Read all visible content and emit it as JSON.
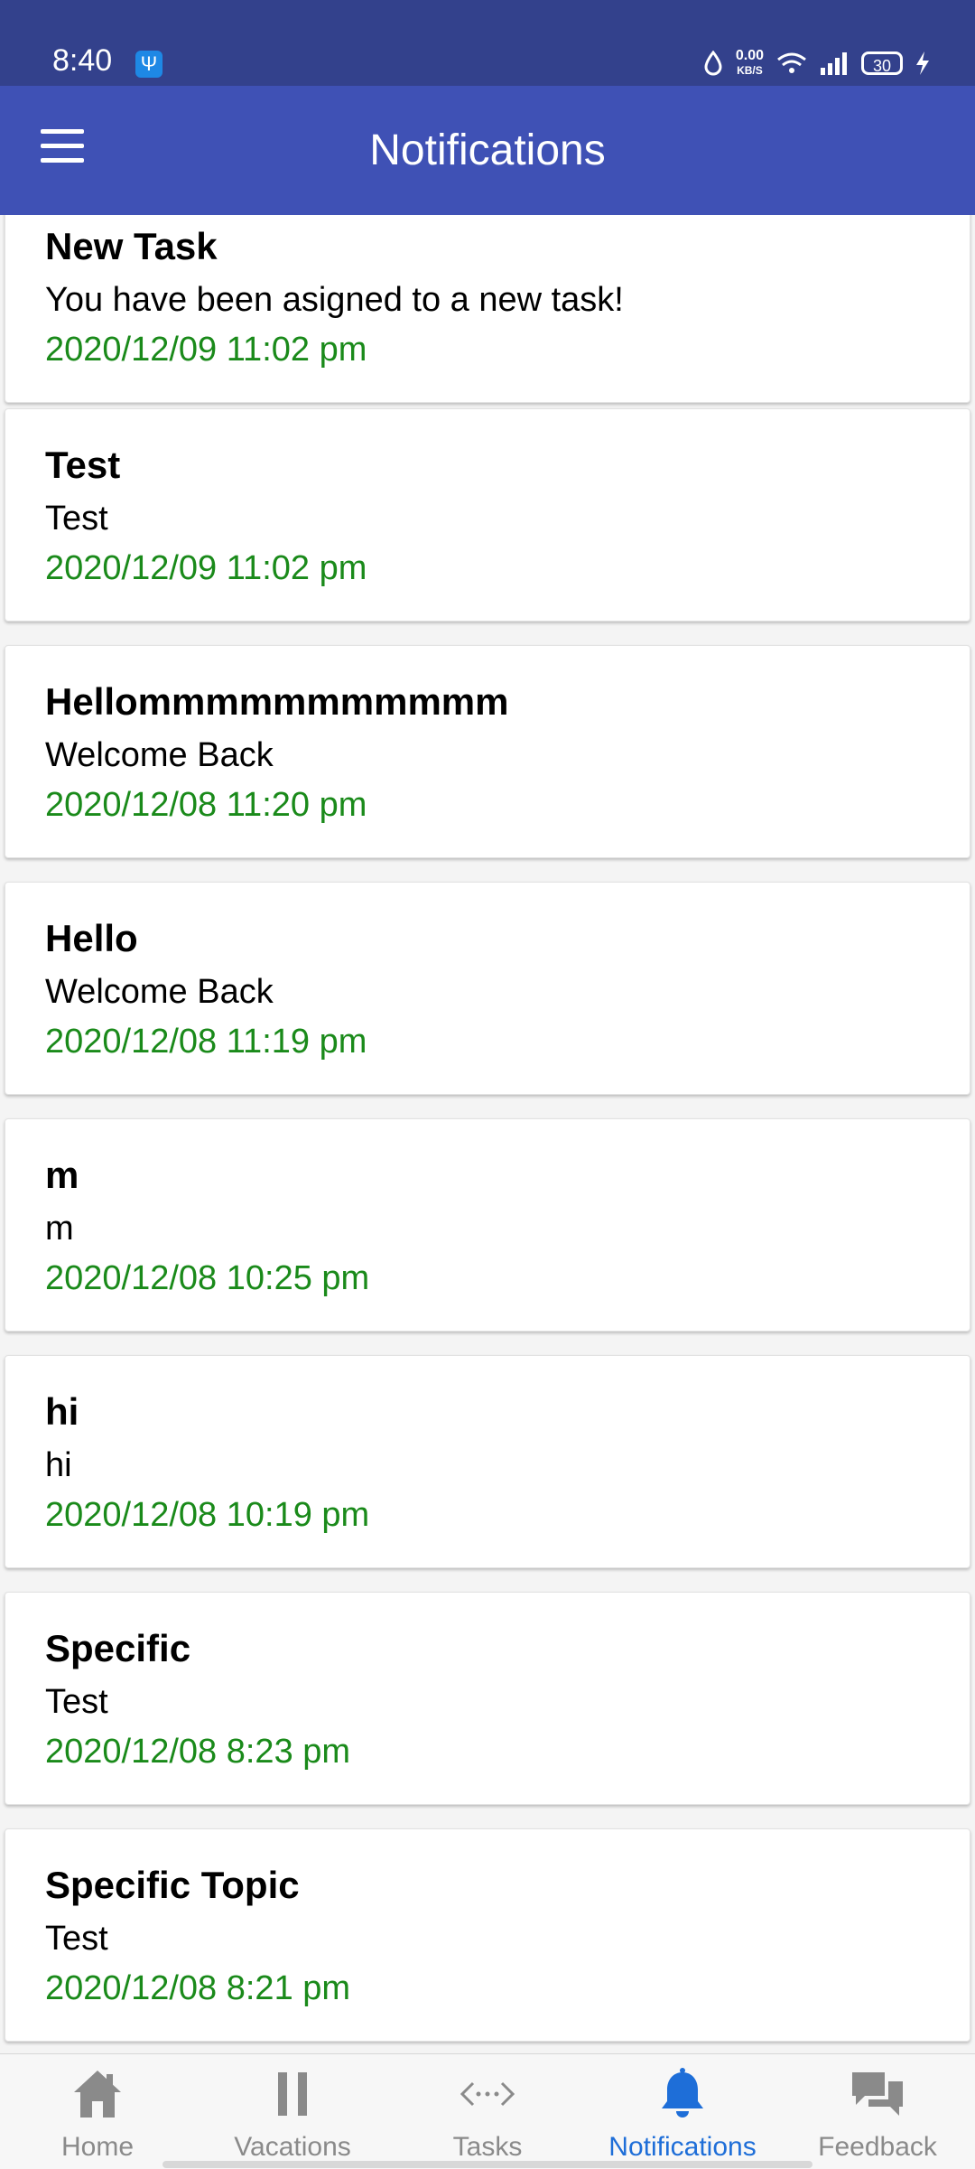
{
  "status_bar": {
    "time": "8:40",
    "net_speed_value": "0.00",
    "net_speed_unit": "KB/S",
    "battery_level": "30"
  },
  "app_bar": {
    "title": "Notifications"
  },
  "notifications": [
    {
      "title": "New Task",
      "body": "You have been asigned to a new task!",
      "time": "2020/12/09 11:02 pm"
    },
    {
      "title": "Test",
      "body": "Test",
      "time": "2020/12/09 11:02 pm"
    },
    {
      "title": "Hellommmmmmmmmmm",
      "body": "Welcome Back",
      "time": "2020/12/08 11:20 pm"
    },
    {
      "title": "Hello",
      "body": "Welcome Back",
      "time": "2020/12/08 11:19 pm"
    },
    {
      "title": "m",
      "body": "m",
      "time": "2020/12/08 10:25 pm"
    },
    {
      "title": "hi",
      "body": "hi",
      "time": "2020/12/08 10:19 pm"
    },
    {
      "title": "Specific",
      "body": "Test",
      "time": "2020/12/08 8:23 pm"
    },
    {
      "title": "Specific Topic",
      "body": "Test",
      "time": "2020/12/08 8:21 pm"
    }
  ],
  "bottom_nav": [
    {
      "label": "Home",
      "icon": "home-icon"
    },
    {
      "label": "Vacations",
      "icon": "pause-icon"
    },
    {
      "label": "Tasks",
      "icon": "code-arrows-icon"
    },
    {
      "label": "Notifications",
      "icon": "bell-icon",
      "active": true
    },
    {
      "label": "Feedback",
      "icon": "chat-bubbles-icon"
    }
  ],
  "colors": {
    "status_bar": "#33418c",
    "app_bar": "#3f51b5",
    "timestamp": "#1a8a1a",
    "nav_active": "#1e6ed8",
    "nav_inactive": "#8a8a8a"
  }
}
